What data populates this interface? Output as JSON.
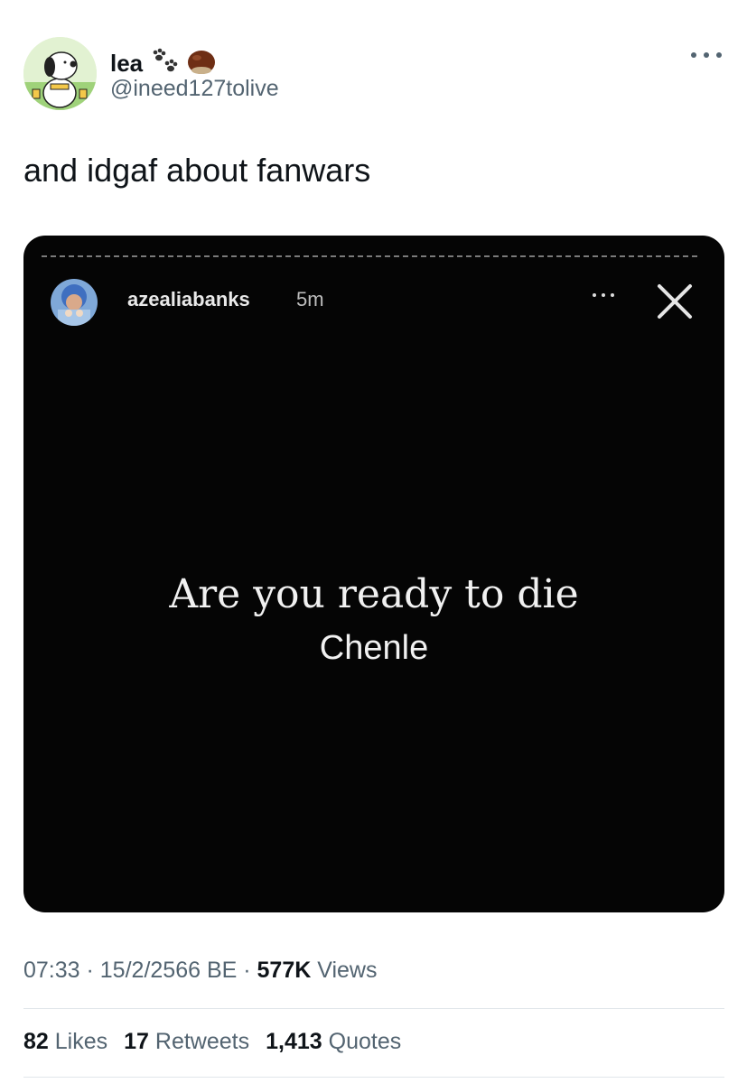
{
  "author": {
    "display_name": "lea",
    "handle": "@ineed127tolive",
    "emojis": [
      "paw-prints-icon",
      "chestnut-icon"
    ],
    "avatar": "snoopy-avatar"
  },
  "tweet": {
    "text": "and idgaf about fanwars"
  },
  "story": {
    "username": "azealiabanks",
    "time": "5m",
    "line1": "Are you ready to die",
    "line2": "Chenle"
  },
  "meta": {
    "time": "07:33",
    "sep1": " · ",
    "date": "15/2/2566 BE",
    "sep2": " · ",
    "views_count": "577K",
    "views_label": "Views"
  },
  "stats": {
    "likes_count": "82",
    "likes_label": "Likes",
    "retweets_count": "17",
    "retweets_label": "Retweets",
    "quotes_count": "1,413",
    "quotes_label": "Quotes"
  },
  "colors": {
    "text": "#0f1419",
    "secondary": "#536471",
    "media_bg": "#050505"
  }
}
